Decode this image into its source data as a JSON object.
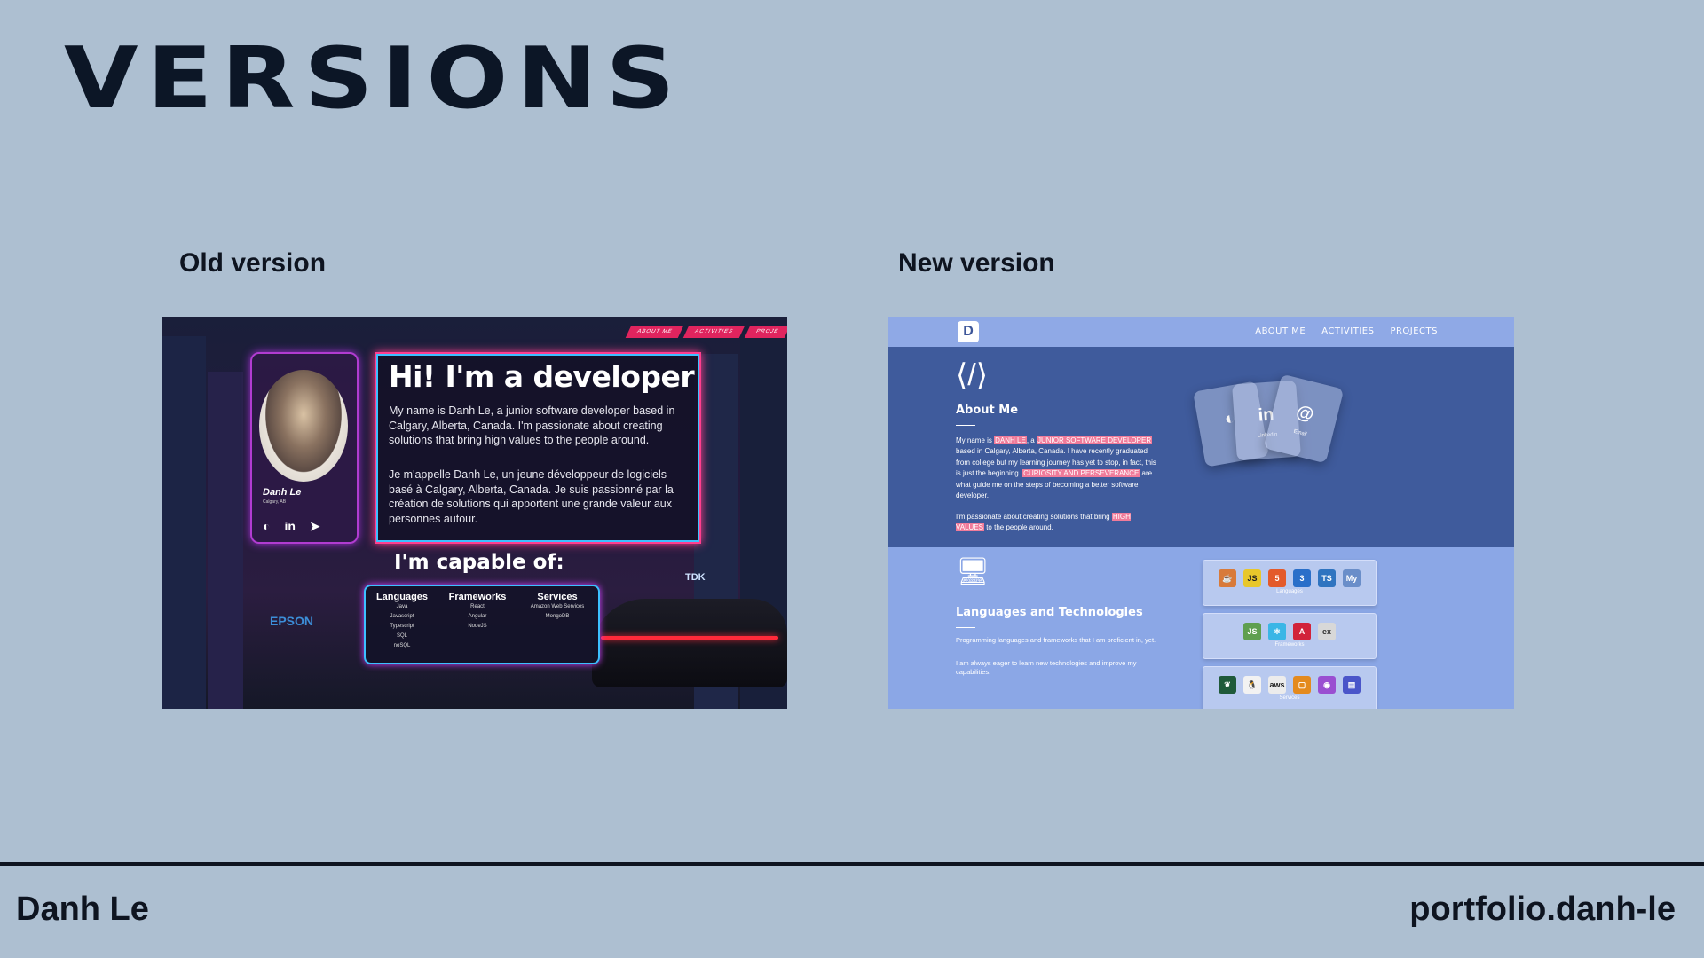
{
  "slide": {
    "title": "VERSIONS",
    "old_caption": "Old version",
    "new_caption": "New version",
    "footer_left": "Danh Le",
    "footer_right": "portfolio.danh-le"
  },
  "old_site": {
    "nav": [
      "ABOUT ME",
      "ACTIVITIES",
      "PROJE"
    ],
    "profile_name": "Danh Le",
    "profile_location": "Calgary, AB",
    "hero_title": "Hi! I'm a developer",
    "intro_en": "My name is Danh Le, a junior software developer based in Calgary, Alberta, Canada. I'm passionate about creating solutions that bring high values to the people around.",
    "intro_fr": "Je m'appelle Danh Le, un jeune développeur de logiciels basé à Calgary, Alberta, Canada. Je suis passionné par la création de solutions qui apportent une grande valeur aux personnes autour.",
    "capable_title": "I'm capable of:",
    "columns": [
      {
        "heading": "Languages",
        "items": [
          "Java",
          "Javascript",
          "Typescript",
          "SQL",
          "noSQL"
        ]
      },
      {
        "heading": "Frameworks",
        "items": [
          "React",
          "Angular",
          "NodeJS"
        ]
      },
      {
        "heading": "Services",
        "items": [
          "Amazon Web Services",
          "MongoDB"
        ]
      }
    ],
    "sign_epson": "EPSON",
    "sign_tdk": "TDK"
  },
  "new_site": {
    "logo": "D",
    "nav": [
      "ABOUT ME",
      "ACTIVITIES",
      "PROJECTS"
    ],
    "about_title": "About Me",
    "about_p1": {
      "a": "My name is ",
      "b": "DANH LE",
      "c": ", a ",
      "d": "JUNIOR SOFTWARE DEVELOPER",
      "e": " based in Calgary, Alberta, Canada. I have recently graduated from college but my learning journey has yet to stop, in fact, this is just the beginning. ",
      "f": "CURIOSITY AND PERSEVERANCE",
      "g": " are what guide me on the steps of becoming a better software developer."
    },
    "about_p2": {
      "a": "I'm passionate about creating solutions that bring ",
      "b": "HIGH VALUES",
      "c": " to the people around."
    },
    "cards": [
      {
        "icon": "github-icon",
        "glyph": "◐",
        "label": ""
      },
      {
        "icon": "linkedin-icon",
        "glyph": "in",
        "label": "Linkedin"
      },
      {
        "icon": "email-icon",
        "glyph": "@",
        "label": "Email"
      }
    ],
    "lt_title": "Languages and Technologies",
    "lt_p1": "Programming languages and frameworks that I am proficient in, yet.",
    "lt_p2": "I am always eager to learn new technologies and improve my capabilities.",
    "tiles": [
      {
        "label": "Languages",
        "icons": [
          {
            "name": "java-icon",
            "glyph": "☕",
            "color": "#d87a3a"
          },
          {
            "name": "javascript-icon",
            "glyph": "JS",
            "color": "#e8c72b"
          },
          {
            "name": "html5-icon",
            "glyph": "5",
            "color": "#e35a2b"
          },
          {
            "name": "css3-icon",
            "glyph": "3",
            "color": "#2a6fc9"
          },
          {
            "name": "typescript-icon",
            "glyph": "TS",
            "color": "#2f74c0"
          },
          {
            "name": "mysql-icon",
            "glyph": "My",
            "color": "#6a8ec9"
          }
        ]
      },
      {
        "label": "Frameworks",
        "icons": [
          {
            "name": "nodejs-icon",
            "glyph": "JS",
            "color": "#5f9f4f"
          },
          {
            "name": "react-icon",
            "glyph": "⚛",
            "color": "#3ab6e6"
          },
          {
            "name": "angular-icon",
            "glyph": "A",
            "color": "#d2233a"
          },
          {
            "name": "express-icon",
            "glyph": "ex",
            "color": "#d8d8d8"
          }
        ]
      },
      {
        "label": "Services",
        "icons": [
          {
            "name": "mongodb-icon",
            "glyph": "❦",
            "color": "#1f5a3a"
          },
          {
            "name": "linux-icon",
            "glyph": "🐧",
            "color": "#f2f2f2"
          },
          {
            "name": "aws-icon",
            "glyph": "aws",
            "color": "#ececec"
          },
          {
            "name": "aws-ec2-icon",
            "glyph": "▢",
            "color": "#e48a1e"
          },
          {
            "name": "aws-cognito-icon",
            "glyph": "◉",
            "color": "#9a4fd1"
          },
          {
            "name": "aws-docs-icon",
            "glyph": "▤",
            "color": "#4a55c9"
          }
        ]
      }
    ]
  }
}
